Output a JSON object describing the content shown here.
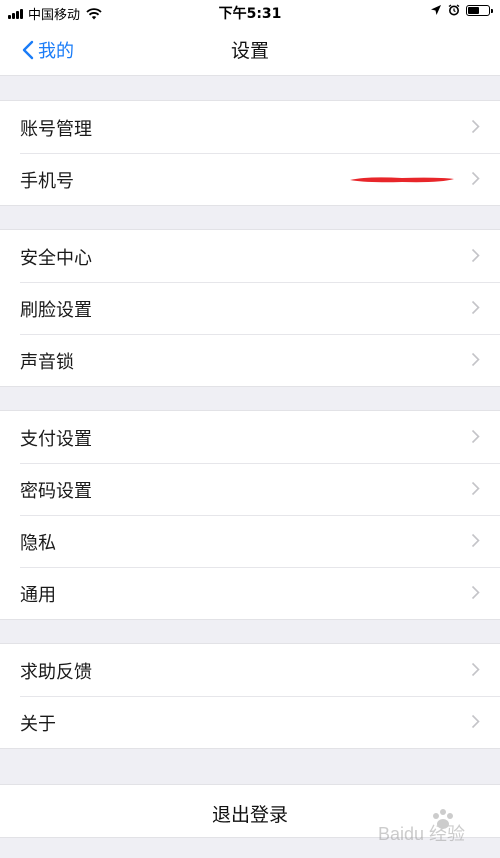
{
  "status_bar": {
    "carrier": "中国移动",
    "time": "下午5:31",
    "icons": [
      "signal-icon",
      "wifi-icon",
      "location-icon",
      "alarm-icon",
      "battery-icon"
    ]
  },
  "nav": {
    "back_label": "我的",
    "title": "设置",
    "accent_color": "#1a7cf7"
  },
  "groups": [
    {
      "items": [
        {
          "label": "账号管理"
        },
        {
          "label": "手机号",
          "value_redacted": true
        }
      ]
    },
    {
      "items": [
        {
          "label": "安全中心"
        },
        {
          "label": "刷脸设置"
        },
        {
          "label": "声音锁"
        }
      ]
    },
    {
      "items": [
        {
          "label": "支付设置"
        },
        {
          "label": "密码设置"
        },
        {
          "label": "隐私"
        },
        {
          "label": "通用"
        }
      ]
    },
    {
      "items": [
        {
          "label": "求助反馈"
        },
        {
          "label": "关于"
        }
      ]
    }
  ],
  "logout": {
    "label": "退出登录"
  },
  "watermark": {
    "text": "Baidu 经验",
    "icon": "baidu-paw-icon"
  }
}
